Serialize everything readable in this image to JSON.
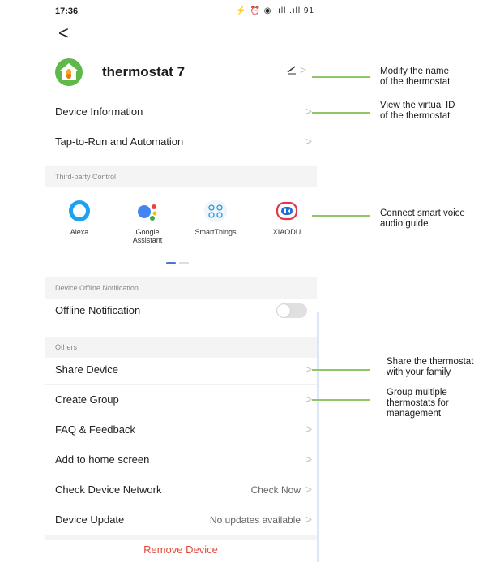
{
  "status_bar": {
    "time": "17:36",
    "icons": "⚡ ⏰ ◉ .ıll .ıll 91"
  },
  "back_glyph": "<",
  "device": {
    "name": "thermostat 7",
    "edit_glyph": "⁄"
  },
  "rows_top": [
    {
      "label": "Device Information"
    },
    {
      "label": "Tap-to-Run and Automation"
    }
  ],
  "third_party": {
    "section_title": "Third-party Control",
    "services": [
      {
        "name": "Alexa",
        "color": "#1da1f2"
      },
      {
        "name": "Google\nAssistant",
        "color": "#4285f4"
      },
      {
        "name": "SmartThings",
        "color": "#2a9bd7"
      },
      {
        "name": "XIAODU",
        "color": "#e03a4a"
      }
    ]
  },
  "offline": {
    "section_title": "Device Offline Notification",
    "label": "Offline Notification"
  },
  "others": {
    "section_title": "Others",
    "rows": [
      {
        "label": "Share Device",
        "value": ""
      },
      {
        "label": "Create Group",
        "value": ""
      },
      {
        "label": "FAQ & Feedback",
        "value": ""
      },
      {
        "label": "Add to home screen",
        "value": ""
      },
      {
        "label": "Check Device Network",
        "value": "Check Now"
      },
      {
        "label": "Device Update",
        "value": "No updates available"
      }
    ]
  },
  "remove_label": "Remove Device",
  "annotations": [
    "Modify the name\nof the thermostat",
    "View the virtual ID\n of the thermostat",
    "Connect smart voice\n audio guide",
    "Share the thermostat\nwith your family",
    "Group multiple\nthermostats for\nmanagement"
  ],
  "colors": {
    "annotation_line": "#8dc76a",
    "remove": "#e34b3c",
    "accent": "#4a78d0"
  }
}
